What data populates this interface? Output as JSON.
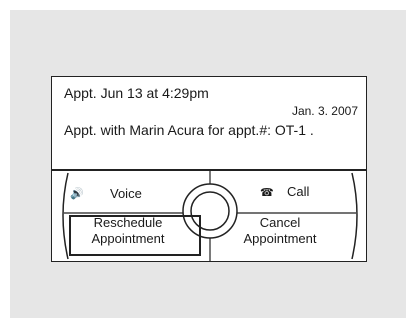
{
  "appointment": {
    "title": "Appt. Jun  13 at  4:29pm",
    "date": "Jan. 3. 2007",
    "detail": "Appt. with Marin Acura for appt.#: OT-1 ."
  },
  "controls": {
    "voice_label": "Voice",
    "call_label": "Call",
    "reschedule_label": [
      "Reschedule",
      "Appointment"
    ],
    "cancel_label": [
      "Cancel",
      "Appointment"
    ]
  },
  "icons": {
    "voice": "speaker-icon",
    "call": "phone-handset-icon"
  }
}
